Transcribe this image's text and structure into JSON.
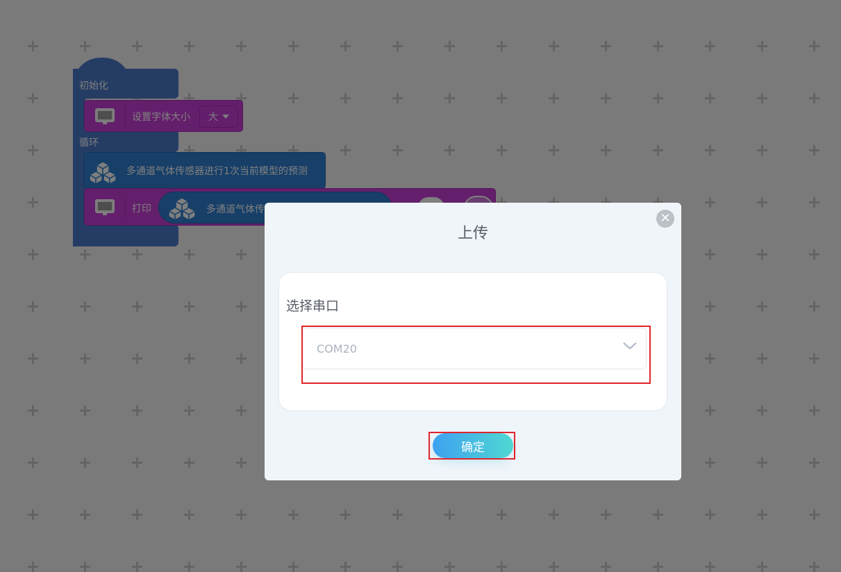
{
  "workspace": {
    "blocks": {
      "init_label": "初始化",
      "set_font_label": "设置字体大小",
      "font_size_value": "大",
      "loop_label": "循环",
      "predict_label": "多通道气体传感器进行1次当前模型的预测",
      "print_label": "打印",
      "print_reporter_label": "多通道气体传"
    }
  },
  "dialog": {
    "title": "上传",
    "close_symbol": "✕",
    "port_label": "选择串口",
    "port_value": "COM20",
    "confirm_label": "确定"
  },
  "colors": {
    "control_blue": "#4b79c9",
    "display_purple": "#c93fd8",
    "sensor_blue": "#2f7fd0",
    "highlight_red": "#e0242b",
    "confirm_gradient_start": "#3ea1f0",
    "confirm_gradient_end": "#4fd8d2"
  },
  "icons": [
    "screen-icon",
    "cubes-icon",
    "close-icon",
    "chevron-down-icon"
  ]
}
